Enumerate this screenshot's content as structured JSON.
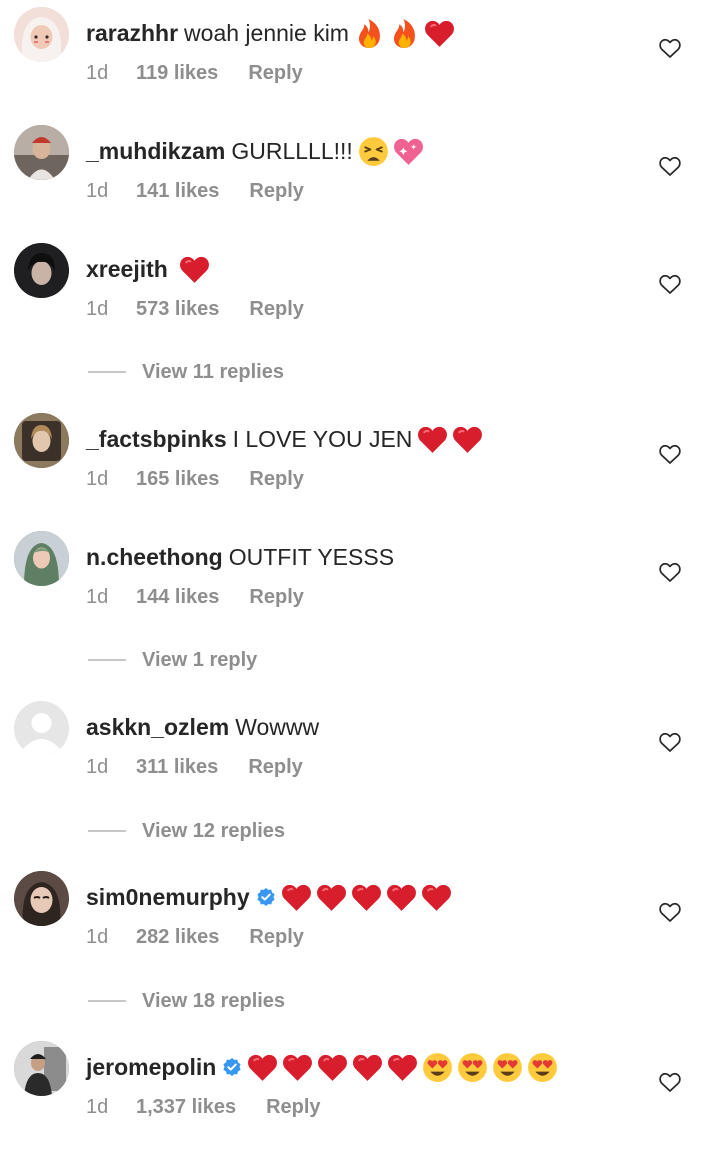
{
  "comments": [
    {
      "username": "rarazhhr",
      "text": "woah jennie kim",
      "emojis": [
        "fire",
        "fire",
        "red-heart"
      ],
      "time": "1d",
      "likes": "119 likes",
      "reply": "Reply",
      "verified": false,
      "avatar_color": "#e9d4cf"
    },
    {
      "username": "_muhdikzam",
      "text": "GURLLLL!!!",
      "emojis": [
        "weary-face",
        "sparkling-heart"
      ],
      "time": "1d",
      "likes": "141 likes",
      "reply": "Reply",
      "verified": false,
      "avatar_color": "#8a7e74"
    },
    {
      "username": "xreejith",
      "text": "",
      "emojis": [
        "red-heart"
      ],
      "time": "1d",
      "likes": "573 likes",
      "reply": "Reply",
      "verified": false,
      "avatar_color": "#2b2b2e"
    },
    {
      "username": "_factsbpinks",
      "text": "I LOVE YOU JEN",
      "emojis": [
        "red-heart",
        "red-heart"
      ],
      "time": "1d",
      "likes": "165 likes",
      "reply": "Reply",
      "verified": false,
      "avatar_color": "#6b5a44"
    },
    {
      "username": "n.cheethong",
      "text": "OUTFIT YESSS",
      "emojis": [],
      "time": "1d",
      "likes": "144 likes",
      "reply": "Reply",
      "verified": false,
      "avatar_color": "#7d8f7a"
    },
    {
      "username": "askkn_ozlem",
      "text": "Wowww",
      "emojis": [],
      "time": "1d",
      "likes": "311 likes",
      "reply": "Reply",
      "verified": false,
      "avatar_color": "#e6e6e6"
    },
    {
      "username": "sim0nemurphy",
      "text": "",
      "emojis": [
        "red-heart",
        "red-heart",
        "red-heart",
        "red-heart",
        "red-heart"
      ],
      "time": "1d",
      "likes": "282 likes",
      "reply": "Reply",
      "verified": true,
      "avatar_color": "#4a3f3a"
    },
    {
      "username": "jeromepolin",
      "text": "",
      "emojis": [
        "red-heart",
        "red-heart",
        "red-heart",
        "red-heart",
        "red-heart",
        "heart-eyes",
        "heart-eyes",
        "heart-eyes",
        "heart-eyes"
      ],
      "time": "1d",
      "likes": "1,337 likes",
      "reply": "Reply",
      "verified": true,
      "avatar_color": "#9a9a9a"
    }
  ],
  "view_replies": [
    "View 11 replies",
    "View 1 reply",
    "View 12 replies",
    "View 18 replies"
  ],
  "colors": {
    "text": "#262626",
    "secondary": "#8e8e8e",
    "verified": "#3897f0",
    "heart": "#e0202c"
  }
}
